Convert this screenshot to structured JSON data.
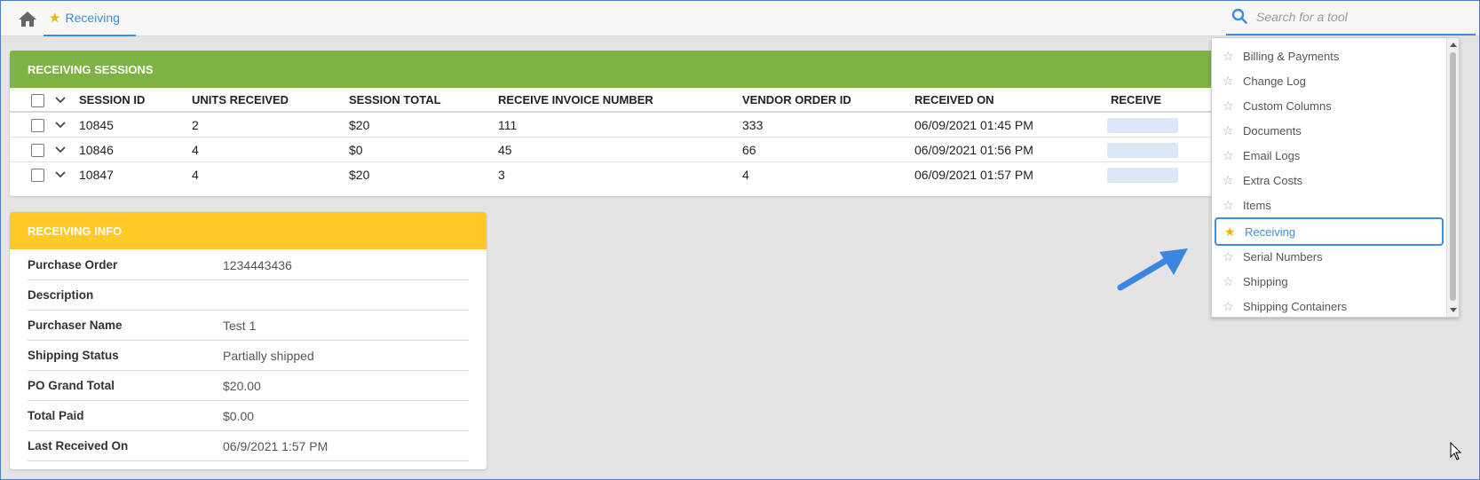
{
  "topbar": {
    "home_icon": "home-icon",
    "favorite_tab_label": "Receiving",
    "search_placeholder": "Search for a tool",
    "accent_color": "#3d8ee0"
  },
  "sessions_panel": {
    "title": "RECEIVING SESSIONS",
    "header_color": "#7cb342",
    "columns": [
      "SESSION ID",
      "UNITS RECEIVED",
      "SESSION TOTAL",
      "RECEIVE INVOICE NUMBER",
      "VENDOR ORDER ID",
      "RECEIVED ON",
      "RECEIVE"
    ],
    "rows": [
      {
        "session_id": "10845",
        "units_received": "2",
        "session_total": "$20",
        "invoice_number": "111",
        "vendor_order_id": "333",
        "received_on": "06/09/2021 01:45 PM"
      },
      {
        "session_id": "10846",
        "units_received": "4",
        "session_total": "$0",
        "invoice_number": "45",
        "vendor_order_id": "66",
        "received_on": "06/09/2021 01:56 PM"
      },
      {
        "session_id": "10847",
        "units_received": "4",
        "session_total": "$20",
        "invoice_number": "3",
        "vendor_order_id": "4",
        "received_on": "06/09/2021 01:57 PM"
      }
    ]
  },
  "info_panel": {
    "title": "RECEIVING INFO",
    "header_color": "#ffca28",
    "fields": [
      {
        "label": "Purchase Order",
        "value": "1234443436"
      },
      {
        "label": "Description",
        "value": ""
      },
      {
        "label": "Purchaser Name",
        "value": "Test 1"
      },
      {
        "label": "Shipping Status",
        "value": "Partially shipped"
      },
      {
        "label": "PO Grand Total",
        "value": "$20.00"
      },
      {
        "label": "Total Paid",
        "value": "$0.00"
      },
      {
        "label": "Last Received On",
        "value": "06/9/2021 1:57 PM"
      }
    ]
  },
  "tool_dropdown": {
    "items": [
      {
        "label": "Billing & Payments",
        "favorite": false
      },
      {
        "label": "Change Log",
        "favorite": false
      },
      {
        "label": "Custom Columns",
        "favorite": false
      },
      {
        "label": "Documents",
        "favorite": false
      },
      {
        "label": "Email Logs",
        "favorite": false
      },
      {
        "label": "Extra Costs",
        "favorite": false
      },
      {
        "label": "Items",
        "favorite": false
      },
      {
        "label": "Receiving",
        "favorite": true,
        "selected": true
      },
      {
        "label": "Serial Numbers",
        "favorite": false
      },
      {
        "label": "Shipping",
        "favorite": false
      },
      {
        "label": "Shipping Containers",
        "favorite": false
      }
    ],
    "favorite_star_color": "#f0b400",
    "highlight_color": "#3d8ee0"
  }
}
